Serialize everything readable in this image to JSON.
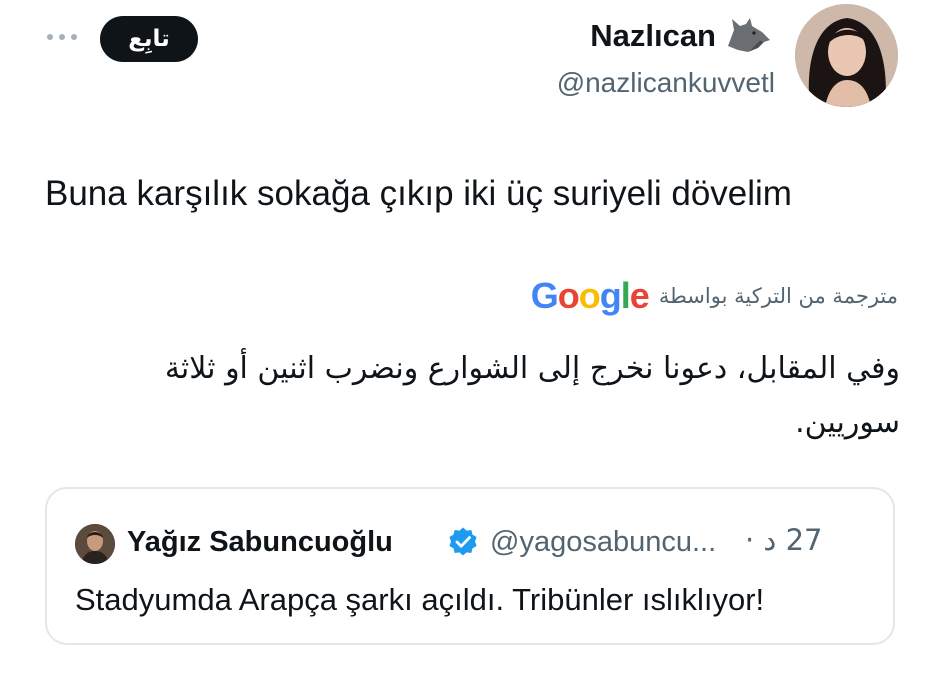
{
  "header": {
    "display_name": "Nazlıcan",
    "handle": "@nazlicankuvvetl",
    "follow_label": "تابِع",
    "more_icon": "ellipsis-icon",
    "name_badge_icon": "wolf-icon"
  },
  "tweet": {
    "text": "Buna karşılık sokağa çıkıp iki üç suriyeli dövelim",
    "translated_by_label": "مترجمة من التركية بواسطة",
    "translator_logo": "Google",
    "translation": "وفي المقابل، دعونا نخرج إلى الشوارع ونضرب اثنين أو ثلاثة سوريين."
  },
  "quoted_tweet": {
    "author_name": "Yağız Sabuncuoğlu",
    "author_handle": "@yagosabuncu...",
    "time": "27 د ·",
    "text": "Stadyumda Arapça şarkı açıldı. Tribünler ıslıklıyor!",
    "verified": true
  },
  "colors": {
    "text": "#0f1419",
    "secondary": "#536471",
    "follow_bg": "#0f1419",
    "verified": "#1d9bf0",
    "border": "#e3e7ea",
    "google_blue": "#4285F4",
    "google_red": "#EA4335",
    "google_yellow": "#FBBC05",
    "google_green": "#34A853"
  }
}
